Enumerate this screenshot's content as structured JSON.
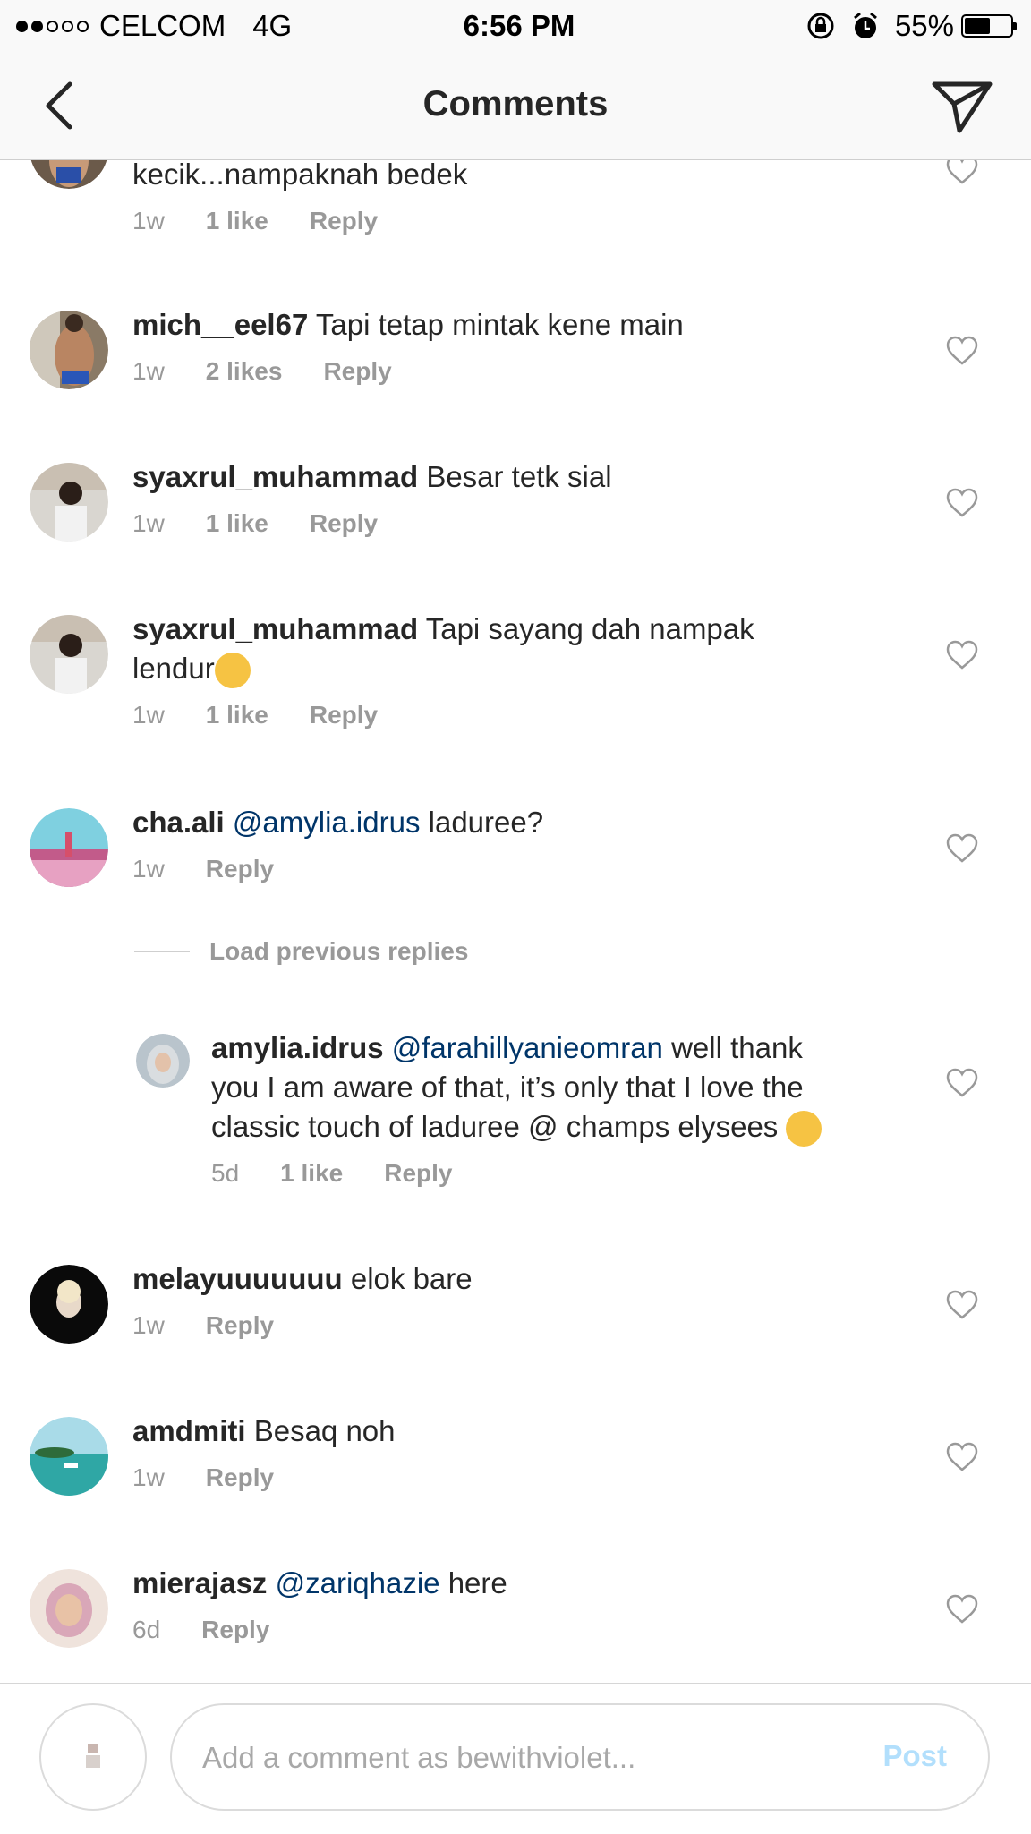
{
  "status_bar": {
    "carrier": "CELCOM",
    "network": "4G",
    "time": "6:56 PM",
    "battery": "55%",
    "battery_level": 0.55
  },
  "nav": {
    "title": "Comments",
    "back_icon": "chevron-left-icon",
    "send_icon": "paper-plane-icon"
  },
  "comments": [
    {
      "username": "",
      "text": "kecik...nampaknah bedek",
      "age": "1w",
      "likes": "1 like",
      "reply": "Reply"
    },
    {
      "username": "mich__eel67",
      "text": "Tapi tetap mintak kene main",
      "age": "1w",
      "likes": "2 likes",
      "reply": "Reply"
    },
    {
      "username": "syaxrul_muhammad",
      "text": "Besar tetk sial",
      "age": "1w",
      "likes": "1 like",
      "reply": "Reply"
    },
    {
      "username": "syaxrul_muhammad",
      "text": "Tapi sayang dah nampak",
      "text2": "lendur",
      "age": "1w",
      "likes": "1 like",
      "reply": "Reply"
    },
    {
      "username": "cha.ali",
      "mention": "@amylia.idrus",
      "text": "laduree?",
      "age": "1w",
      "reply": "Reply"
    }
  ],
  "load_previous": "Load previous replies",
  "reply_comment": {
    "username": "amylia.idrus",
    "mention": "@farahillyanieomran",
    "line1": "well thank",
    "line2": "you I am aware of that, it’s only that I love the",
    "line3": "classic touch of laduree @ champs elysees",
    "age": "5d",
    "likes": "1 like",
    "reply": "Reply"
  },
  "comments_after": [
    {
      "username": "melayuuuuuuu",
      "text": "elok bare",
      "age": "1w",
      "reply": "Reply"
    },
    {
      "username": "amdmiti",
      "text": "Besaq noh",
      "age": "1w",
      "reply": "Reply"
    },
    {
      "username": "mierajasz",
      "mention": "@zariqhazie",
      "text": "here",
      "age": "6d",
      "reply": "Reply"
    }
  ],
  "input": {
    "placeholder": "Add a comment as bewithviolet...",
    "post_label": "Post"
  },
  "colors": {
    "mention": "#003569",
    "meta": "#999999",
    "post_disabled": "#b2dffc"
  }
}
